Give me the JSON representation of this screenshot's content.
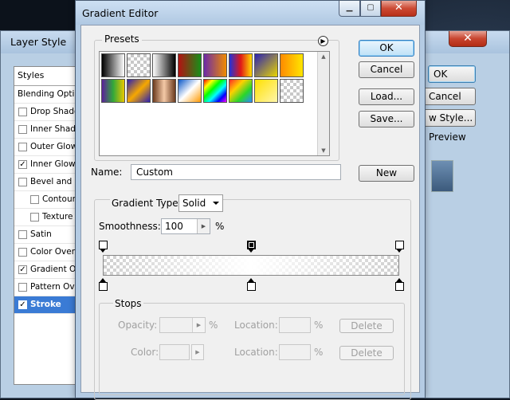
{
  "layer_style": {
    "title": "Layer Style",
    "styles_header": "Styles",
    "items": [
      {
        "label": "Blending Options: Default",
        "checked": false,
        "kind": "plain"
      },
      {
        "label": "Drop Shadow",
        "checked": false,
        "kind": "normal"
      },
      {
        "label": "Inner Shadow",
        "checked": false,
        "kind": "normal"
      },
      {
        "label": "Outer Glow",
        "checked": false,
        "kind": "normal"
      },
      {
        "label": "Inner Glow",
        "checked": true,
        "kind": "normal"
      },
      {
        "label": "Bevel and Emboss",
        "checked": false,
        "kind": "normal"
      },
      {
        "label": "Contour",
        "checked": false,
        "kind": "sub"
      },
      {
        "label": "Texture",
        "checked": false,
        "kind": "sub"
      },
      {
        "label": "Satin",
        "checked": false,
        "kind": "normal"
      },
      {
        "label": "Color Overlay",
        "checked": false,
        "kind": "normal"
      },
      {
        "label": "Gradient Overlay",
        "checked": true,
        "kind": "normal"
      },
      {
        "label": "Pattern Overlay",
        "checked": false,
        "kind": "normal"
      },
      {
        "label": "Stroke",
        "checked": true,
        "kind": "normal",
        "active": true
      }
    ],
    "ok_label": "OK",
    "cancel_label": "Cancel",
    "new_style_label": "w Style...",
    "preview_label": "Preview",
    "close_glyph": "✕"
  },
  "gradient_editor": {
    "title": "Gradient Editor",
    "presets_label": "Presets",
    "presets_menu_glyph": "▶",
    "swatch_colors": [
      [
        "linear-gradient(90deg,#000,#fff)",
        "checker-bw",
        "linear-gradient(90deg,#fff,#000)",
        "linear-gradient(90deg,#b31212,#179019)",
        "linear-gradient(90deg,#6b2aa8,#f08b00)",
        "linear-gradient(90deg,#2233d8,#e01818,#ffdc00)",
        "linear-gradient(135deg,#2a22b4,#e9d500)",
        "linear-gradient(90deg,#ff8a00,#ffe600)"
      ],
      [
        "linear-gradient(90deg,#5b1f9c,#32a83a,#e8c800)",
        "linear-gradient(135deg,#2b1fb2,#f6a800,#2b1fb2)",
        "linear-gradient(90deg,#6b3a1e,#f4c9a6,#6b3a1e)",
        "linear-gradient(135deg,#0a57c7,#ffffff,#ff9900)",
        "linear-gradient(135deg,#ff0000,#ffff00,#00ff00,#00ffff,#0000ff,#ff00ff)",
        "linear-gradient(135deg,#ff2a2a,#ffd000,#2ad62a,#2a8aff)",
        "linear-gradient(135deg,#ffe000,#fff6aa)",
        "checker"
      ]
    ],
    "ok_label": "OK",
    "cancel_label": "Cancel",
    "load_label": "Load...",
    "save_label": "Save...",
    "new_label": "New",
    "name_label": "Name:",
    "name_value": "Custom",
    "gradient_type_label": "Gradient Type:",
    "gradient_type_value": "Solid",
    "smoothness_label": "Smoothness:",
    "smoothness_value": "100",
    "percent": "%",
    "stops_label": "Stops",
    "opacity_label": "Opacity:",
    "color_label": "Color:",
    "location_label": "Location:",
    "delete_label": "Delete",
    "window_glyphs": {
      "minimize": "▁",
      "maximize": "▢",
      "close": "✕"
    },
    "opacity_stops": [
      0,
      50,
      100
    ],
    "color_stops": [
      0,
      50,
      100
    ],
    "selected_opacity_stop": 50
  }
}
